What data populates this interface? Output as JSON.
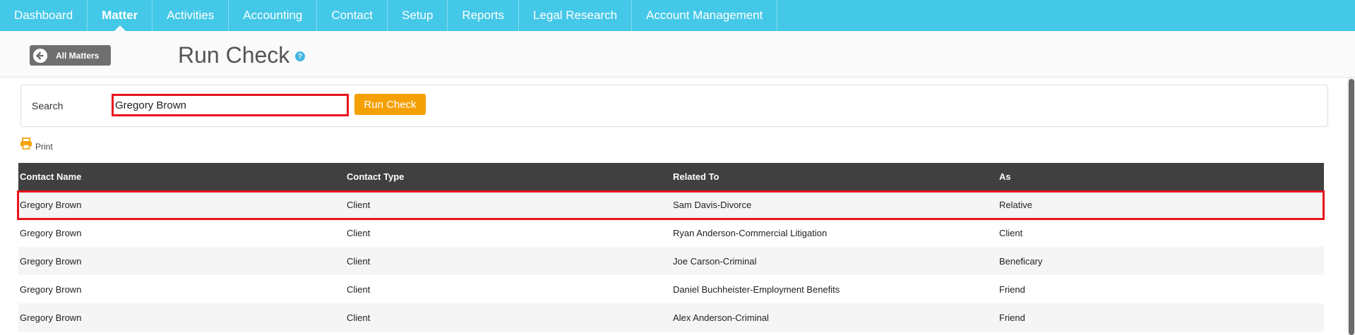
{
  "nav": {
    "items": [
      {
        "label": "Dashboard"
      },
      {
        "label": "Matter"
      },
      {
        "label": "Activities"
      },
      {
        "label": "Accounting"
      },
      {
        "label": "Contact"
      },
      {
        "label": "Setup"
      },
      {
        "label": "Reports"
      },
      {
        "label": "Legal Research"
      },
      {
        "label": "Account Management"
      }
    ],
    "active": "Matter"
  },
  "header": {
    "back_label": "All Matters",
    "title": "Run Check",
    "help_glyph": "?"
  },
  "search": {
    "label": "Search",
    "value": "Gregory Brown",
    "button_label": "Run Check"
  },
  "print": {
    "label": "Print"
  },
  "table": {
    "columns": [
      "Contact Name",
      "Contact Type",
      "Related To",
      "As"
    ],
    "rows": [
      [
        "Gregory Brown",
        "Client",
        "Sam Davis-Divorce",
        "Relative"
      ],
      [
        "Gregory Brown",
        "Client",
        "Ryan Anderson-Commercial Litigation",
        "Client"
      ],
      [
        "Gregory Brown",
        "Client",
        "Joe Carson-Criminal",
        "Beneficary"
      ],
      [
        "Gregory Brown",
        "Client",
        "Daniel Buchheister-Employment Benefits",
        "Friend"
      ],
      [
        "Gregory Brown",
        "Client",
        "Alex Anderson-Criminal",
        "Friend"
      ]
    ]
  },
  "colors": {
    "nav_bg": "#44c8e8",
    "accent_button": "#f5a105",
    "highlight_border": "#e8141c",
    "table_header_bg": "#404040"
  },
  "icons": {
    "back": "arrow-left-circle-icon",
    "help": "question-circle-icon",
    "print": "printer-icon"
  }
}
